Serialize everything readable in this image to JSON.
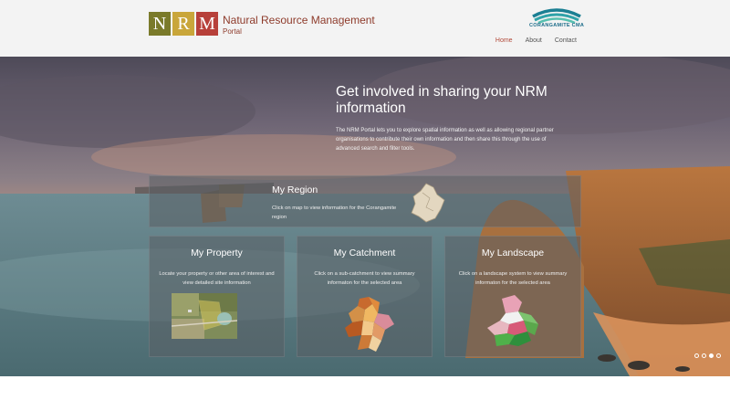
{
  "header": {
    "logo_letters": [
      "N",
      "R",
      "M"
    ],
    "logo_colors": [
      "#7a7a2a",
      "#c9a63a",
      "#b7403a"
    ],
    "logo_title": "Natural Resource Management",
    "logo_subtitle": "Portal",
    "partner_logo_label": "CORANGAMITE CMA",
    "nav": [
      {
        "label": "Home",
        "active": true
      },
      {
        "label": "About",
        "active": false
      },
      {
        "label": "Contact",
        "active": false
      }
    ]
  },
  "hero": {
    "title": "Get involved in sharing your NRM information",
    "description": "The NRM Portal lets you to explore spatial information as well as allowing regional partner organisations to contribute their own information and then share this through the use of advanced search and filter tools.",
    "panels": {
      "region": {
        "title": "My Region",
        "description": "Click on map to view information for the Corangamite region"
      },
      "property": {
        "title": "My Property",
        "description": "Locate your property or other area of interest and view detailed site information"
      },
      "catchment": {
        "title": "My Catchment",
        "description": "Click on a sub-catchment to view summary informaton for the selected area"
      },
      "landscape": {
        "title": "My Landscape",
        "description": "Click on a landscape system to view summary informaton for the selected area"
      }
    },
    "slider": {
      "count": 4,
      "active_index": 2
    }
  }
}
